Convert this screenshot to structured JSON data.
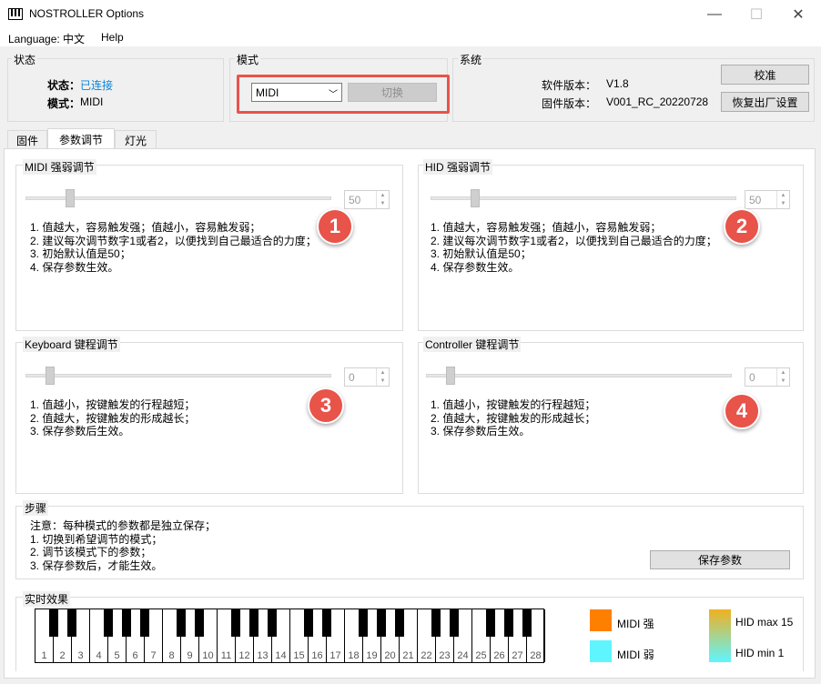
{
  "window": {
    "title": "NOSTROLLER  Options",
    "minimize": "—",
    "maximize": "☐",
    "close": "✕"
  },
  "menu": {
    "language": "Language: 中文",
    "help": "Help"
  },
  "status": {
    "group_label": "状态",
    "state_label": "状态：",
    "state_value": "已连接",
    "mode_label": "模式：",
    "mode_value": "MIDI"
  },
  "mode": {
    "group_label": "模式",
    "select_value": "MIDI",
    "switch_label": "切换"
  },
  "system": {
    "group_label": "系统",
    "sw_label": "软件版本：",
    "sw_value": "V1.8",
    "fw_label": "固件版本：",
    "fw_value": "V001_RC_20220728",
    "calibrate_label": "校准",
    "reset_label": "恢复出厂设置"
  },
  "tabs": [
    {
      "label": "固件"
    },
    {
      "label": "参数调节"
    },
    {
      "label": "灯光"
    }
  ],
  "panels": {
    "midi_strength": {
      "label": "MIDI 强弱调节",
      "value": "50",
      "slider_fraction": 0.27,
      "badge": "1",
      "notes": "1. 值越大，容易触发强；值越小，容易触发弱；\n2. 建议每次调节数字1或者2，以便找到自己最适合的力度；\n3. 初始默认值是50；\n4. 保存参数生效。"
    },
    "hid_strength": {
      "label": "HID 强弱调节",
      "value": "50",
      "slider_fraction": 0.27,
      "badge": "2",
      "notes": "1. 值越大，容易触发强；值越小，容易触发弱；\n2. 建议每次调节数字1或者2，以便找到自己最适合的力度；\n3. 初始默认值是50；\n4. 保存参数生效。"
    },
    "keyboard_travel": {
      "label": "Keyboard 键程调节",
      "value": "0",
      "slider_fraction": 0.0,
      "badge": "3",
      "notes": "1. 值越小，按键触发的行程越短；\n2. 值越大，按键触发的形成越长；\n3. 保存参数后生效。"
    },
    "controller_travel": {
      "label": "Controller 键程调节",
      "value": "0",
      "slider_fraction": 0.0,
      "badge": "4",
      "notes": "1. 值越小，按键触发的行程越短；\n2. 值越大，按键触发的形成越长；\n3. 保存参数后生效。"
    }
  },
  "steps": {
    "label": "步骤",
    "notes": "注意：每种模式的参数都是独立保存；\n1. 切换到希望调节的模式；\n2. 调节该模式下的参数；\n3. 保存参数后，才能生效。",
    "save_label": "保存参数"
  },
  "realtime": {
    "label": "实时效果",
    "keys": [
      "1",
      "2",
      "3",
      "4",
      "5",
      "6",
      "7",
      "8",
      "9",
      "10",
      "11",
      "12",
      "13",
      "14",
      "15",
      "16",
      "17",
      "18",
      "19",
      "20",
      "21",
      "22",
      "23",
      "24",
      "25",
      "26",
      "27",
      "28"
    ],
    "legend": [
      {
        "text": "MIDI 强",
        "color": "#ff8000"
      },
      {
        "text": "MIDI 弱",
        "color": "#5ff5ff"
      },
      {
        "text": "HID max 15",
        "color": "#f0b020"
      },
      {
        "text": "HID min 1",
        "color": "#5ff5ff"
      }
    ]
  }
}
